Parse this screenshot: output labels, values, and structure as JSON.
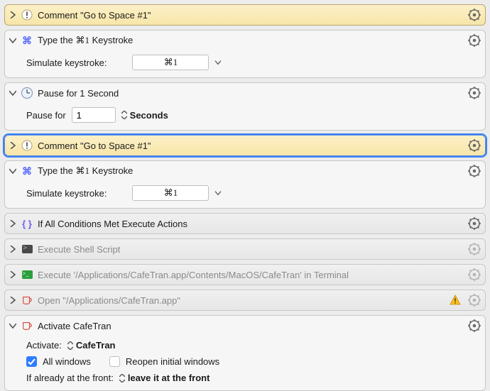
{
  "actions": [
    {
      "kind": "comment",
      "expanded": false,
      "title_prefix": "Comment ",
      "title_quote": "\"Go to Space #1\""
    },
    {
      "kind": "type_keystroke",
      "expanded": true,
      "title_prefix": "Type the ",
      "title_key": "⌘1",
      "title_suffix": " Keystroke",
      "field_label": "Simulate keystroke:",
      "field_value": "⌘1"
    },
    {
      "kind": "pause",
      "expanded": true,
      "title": "Pause for 1 Second",
      "field_label": "Pause for",
      "field_value": "1",
      "unit_label": "Seconds"
    },
    {
      "kind": "comment",
      "expanded": false,
      "selected": true,
      "title_prefix": "Comment ",
      "title_quote": "\"Go to Space #1\""
    },
    {
      "kind": "type_keystroke",
      "expanded": true,
      "title_prefix": "Type the ",
      "title_key": "⌘1",
      "title_suffix": " Keystroke",
      "field_label": "Simulate keystroke:",
      "field_value": "⌘1"
    },
    {
      "kind": "if_conditions",
      "expanded": false,
      "title": "If All Conditions Met Execute Actions"
    },
    {
      "kind": "shell",
      "expanded": false,
      "dimmed": true,
      "title": "Execute Shell Script"
    },
    {
      "kind": "shell_green",
      "expanded": false,
      "dimmed": true,
      "title": "Execute '/Applications/CafeTran.app/Contents/MacOS/CafeTran' in Terminal"
    },
    {
      "kind": "open_app",
      "expanded": false,
      "dimmed": true,
      "warning": true,
      "title": "Open \"/Applications/CafeTran.app\""
    },
    {
      "kind": "activate",
      "expanded": true,
      "title": "Activate CafeTran",
      "activate_label": "Activate:",
      "activate_app": "CafeTran",
      "check_all_windows": true,
      "all_windows_label": "All windows",
      "check_reopen": false,
      "reopen_label": "Reopen initial windows",
      "front_label": "If already at the front:",
      "front_value": "leave it at the front"
    }
  ]
}
